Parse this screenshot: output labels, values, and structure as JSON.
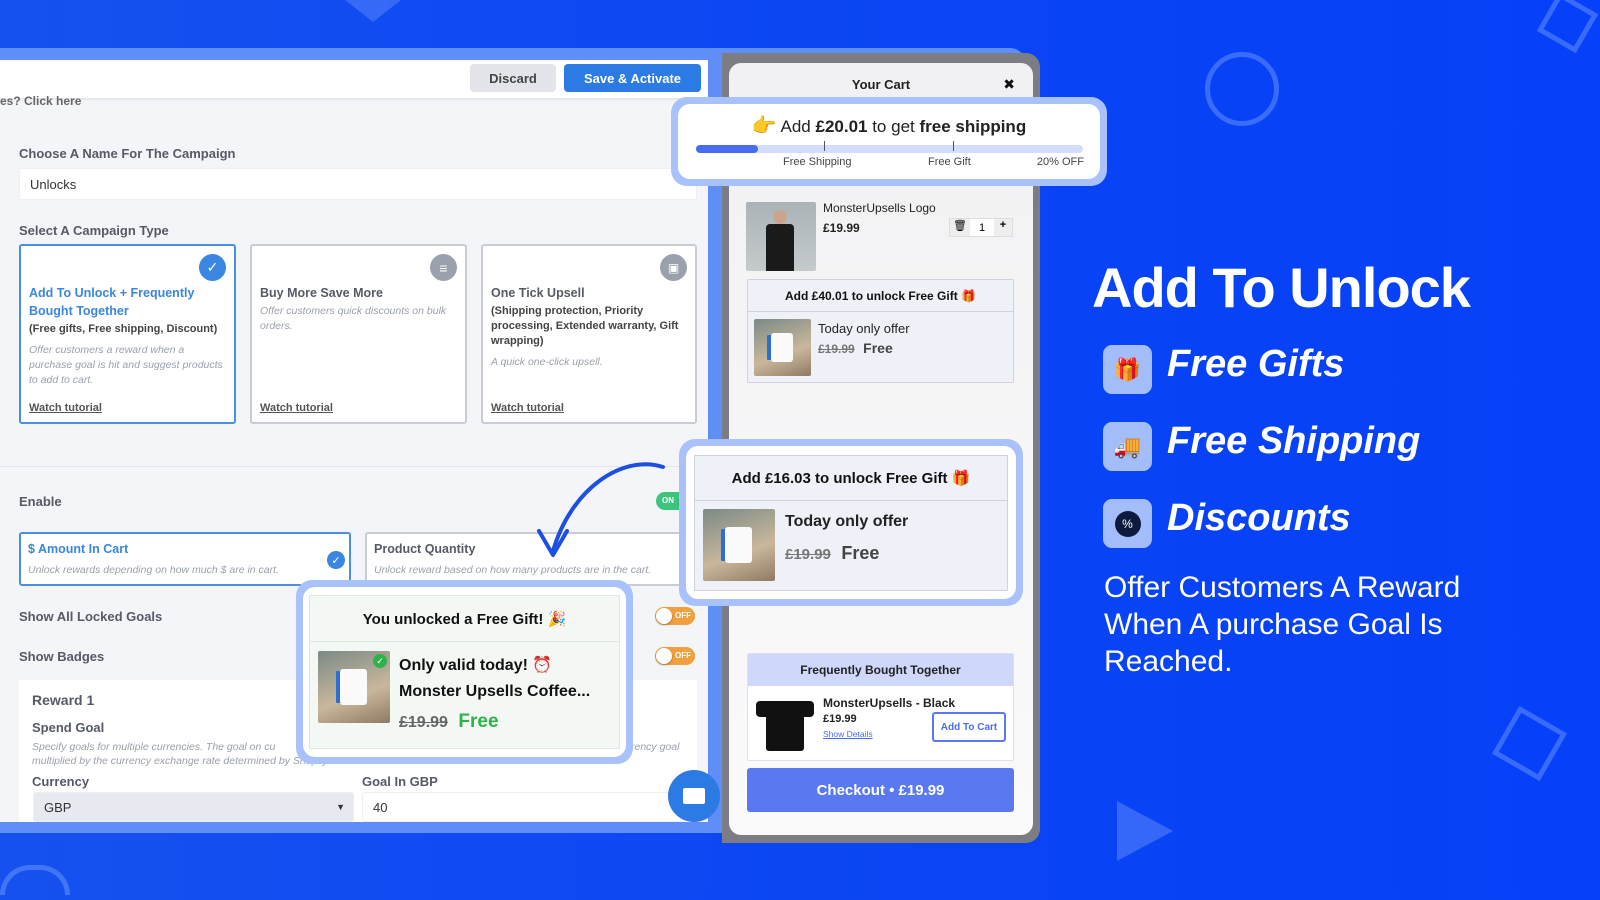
{
  "editor": {
    "discard_label": "Discard",
    "save_label": "Save & Activate",
    "help_link": "es? Click here",
    "campaign_name_label": "Choose A Name For The Campaign",
    "campaign_name_value": "Unlocks",
    "campaign_type_label": "Select A Campaign Type",
    "campaign_types": [
      {
        "title": "Add To Unlock + Frequently Bought Together",
        "subtitle": "(Free gifts, Free shipping, Discount)",
        "desc": "Offer customers a reward when a purchase goal is hit and suggest products to add to cart.",
        "link": "Watch tutorial",
        "selected": true,
        "icon": "check-icon"
      },
      {
        "title": "Buy More Save More",
        "subtitle": "",
        "desc": "Offer customers quick discounts on bulk orders.",
        "link": "Watch tutorial",
        "selected": false,
        "icon": "list-icon"
      },
      {
        "title": "One Tick Upsell",
        "subtitle": "(Shipping protection, Priority processing, Extended warranty, Gift wrapping)",
        "desc": "A quick one-click upsell.",
        "link": "Watch tutorial",
        "selected": false,
        "icon": "box-check-icon"
      }
    ],
    "enable_label": "Enable",
    "enable_state": "ON",
    "goal_types": [
      {
        "title": "$ Amount In Cart",
        "desc": "Unlock rewards depending on how much $ are in cart.",
        "selected": true
      },
      {
        "title": "Product Quantity",
        "desc": "Unlock reward based on how many products are in the cart.",
        "selected": false
      }
    ],
    "show_locked_label": "Show All Locked Goals",
    "show_locked_state": "OFF",
    "show_badges_label": "Show Badges",
    "show_badges_state": "OFF",
    "reward_title": "Reward 1",
    "spend_goal_label": "Spend Goal",
    "spend_goal_desc_1": "Specify goals for multiple currencies. The goal on cu",
    "spend_goal_desc_1b": "rency goal",
    "spend_goal_desc_2": "multiplied by the currency exchange rate determined by Shopify Markets.",
    "currency_label": "Currency",
    "currency_value": "GBP",
    "goal_label": "Goal In GBP",
    "goal_value": "40"
  },
  "unlocked_popup": {
    "header": "You unlocked a Free Gift! 🎉",
    "line1": "Only valid today! ⏰",
    "product": "Monster Upsells Coffee...",
    "old_price": "£19.99",
    "price": "Free"
  },
  "cart": {
    "title": "Your Cart",
    "close": "✖",
    "shipping_bar": {
      "prefix": "Add ",
      "amount": "£20.01",
      "middle": " to get ",
      "goal": "free shipping",
      "progress_percent": 16,
      "milestones": [
        "Free Shipping",
        "Free Gift",
        "20% OFF"
      ]
    },
    "item": {
      "name": "MonsterUpsells Logo",
      "price": "£19.99",
      "quantity": "1"
    },
    "gift_box": {
      "header": "Add £40.01 to unlock Free Gift 🎁",
      "offer": "Today only offer",
      "old_price": "£19.99",
      "price": "Free"
    },
    "gift_popup": {
      "header": "Add £16.03 to unlock Free Gift 🎁",
      "offer": "Today only offer",
      "old_price": "£19.99",
      "price": "Free"
    },
    "fbt": {
      "header": "Frequently Bought Together",
      "name": "MonsterUpsells - Black",
      "price": "£19.99",
      "details": "Show Details",
      "button": "Add To Cart"
    },
    "checkout": "Checkout • £19.99"
  },
  "promo": {
    "title": "Add To Unlock",
    "features": [
      {
        "label": "Free Gifts",
        "icon": "gift-icon"
      },
      {
        "label": "Free Shipping",
        "icon": "truck-icon"
      },
      {
        "label": "Discounts",
        "icon": "discount-icon"
      }
    ],
    "tagline_1": "Offer Customers A Reward",
    "tagline_2": "When A purchase Goal Is",
    "tagline_3": "Reached."
  },
  "colors": {
    "background": "#0a45f2",
    "primary": "#2c7be5",
    "checkout": "#5a78f0",
    "on": "#3cc47c",
    "off": "#f0a03c",
    "free_green": "#2fb24c"
  }
}
